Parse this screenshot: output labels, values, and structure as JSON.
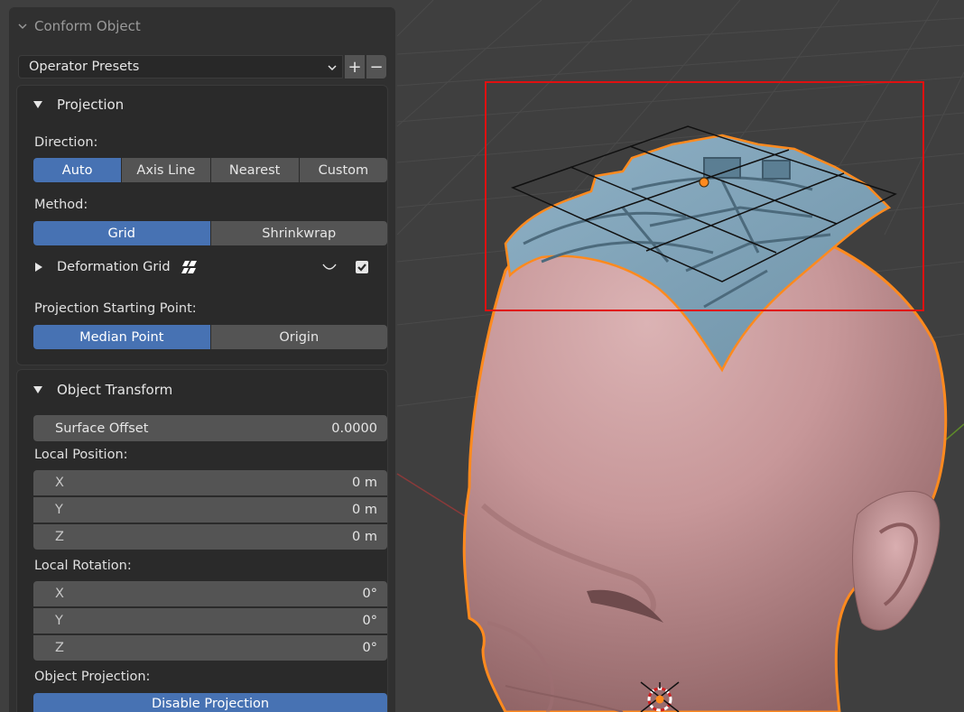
{
  "panel": {
    "title": "Conform Object",
    "presets": {
      "label": "Operator Presets",
      "add": "+",
      "remove": "−"
    }
  },
  "projection": {
    "header": "Projection",
    "direction_label": "Direction:",
    "direction_options": [
      "Auto",
      "Axis Line",
      "Nearest",
      "Custom"
    ],
    "direction_selected": "Auto",
    "method_label": "Method:",
    "method_options": [
      "Grid",
      "Shrinkwrap"
    ],
    "method_selected": "Grid",
    "deformation_grid_label": "Deformation Grid",
    "deformation_grid_enabled": true,
    "start_label": "Projection Starting Point:",
    "start_options": [
      "Median Point",
      "Origin"
    ],
    "start_selected": "Median Point"
  },
  "object_transform": {
    "header": "Object Transform",
    "surface_offset_label": "Surface Offset",
    "surface_offset_value": "0.0000",
    "local_position_label": "Local Position:",
    "position": [
      {
        "axis": "X",
        "value": "0 m"
      },
      {
        "axis": "Y",
        "value": "0 m"
      },
      {
        "axis": "Z",
        "value": "0 m"
      }
    ],
    "local_rotation_label": "Local Rotation:",
    "rotation": [
      {
        "axis": "X",
        "value": "0°"
      },
      {
        "axis": "Y",
        "value": "0°"
      },
      {
        "axis": "Z",
        "value": "0°"
      }
    ],
    "object_projection_label": "Object Projection:",
    "disable_projection": "Disable Projection"
  },
  "colors": {
    "accent": "#4772b3",
    "selection_outline": "#ff8a1e",
    "highlight_frame": "#e01010",
    "head_skin": "#c7999b",
    "armor_mesh": "#7fa2b8"
  }
}
